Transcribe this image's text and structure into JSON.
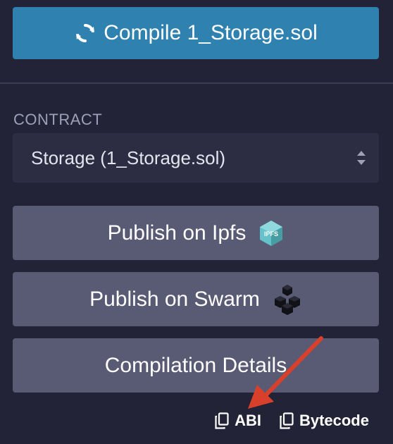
{
  "compile": {
    "label": "Compile 1_Storage.sol",
    "icon": "refresh-icon",
    "color": "#2f82b0"
  },
  "contract": {
    "section_label": "CONTRACT",
    "selected": "Storage (1_Storage.sol)"
  },
  "actions": {
    "publish_ipfs_label": "Publish on Ipfs",
    "ipfs_badge_text": "IPFS",
    "publish_swarm_label": "Publish on Swarm",
    "compilation_details_label": "Compilation Details"
  },
  "copy": {
    "abi_label": "ABI",
    "bytecode_label": "Bytecode",
    "icon": "copy-icon"
  },
  "annotation": {
    "arrow_color": "#d9402b"
  },
  "colors": {
    "background": "#222336",
    "button_secondary": "#595a73",
    "select_bg": "#2c2d42"
  }
}
